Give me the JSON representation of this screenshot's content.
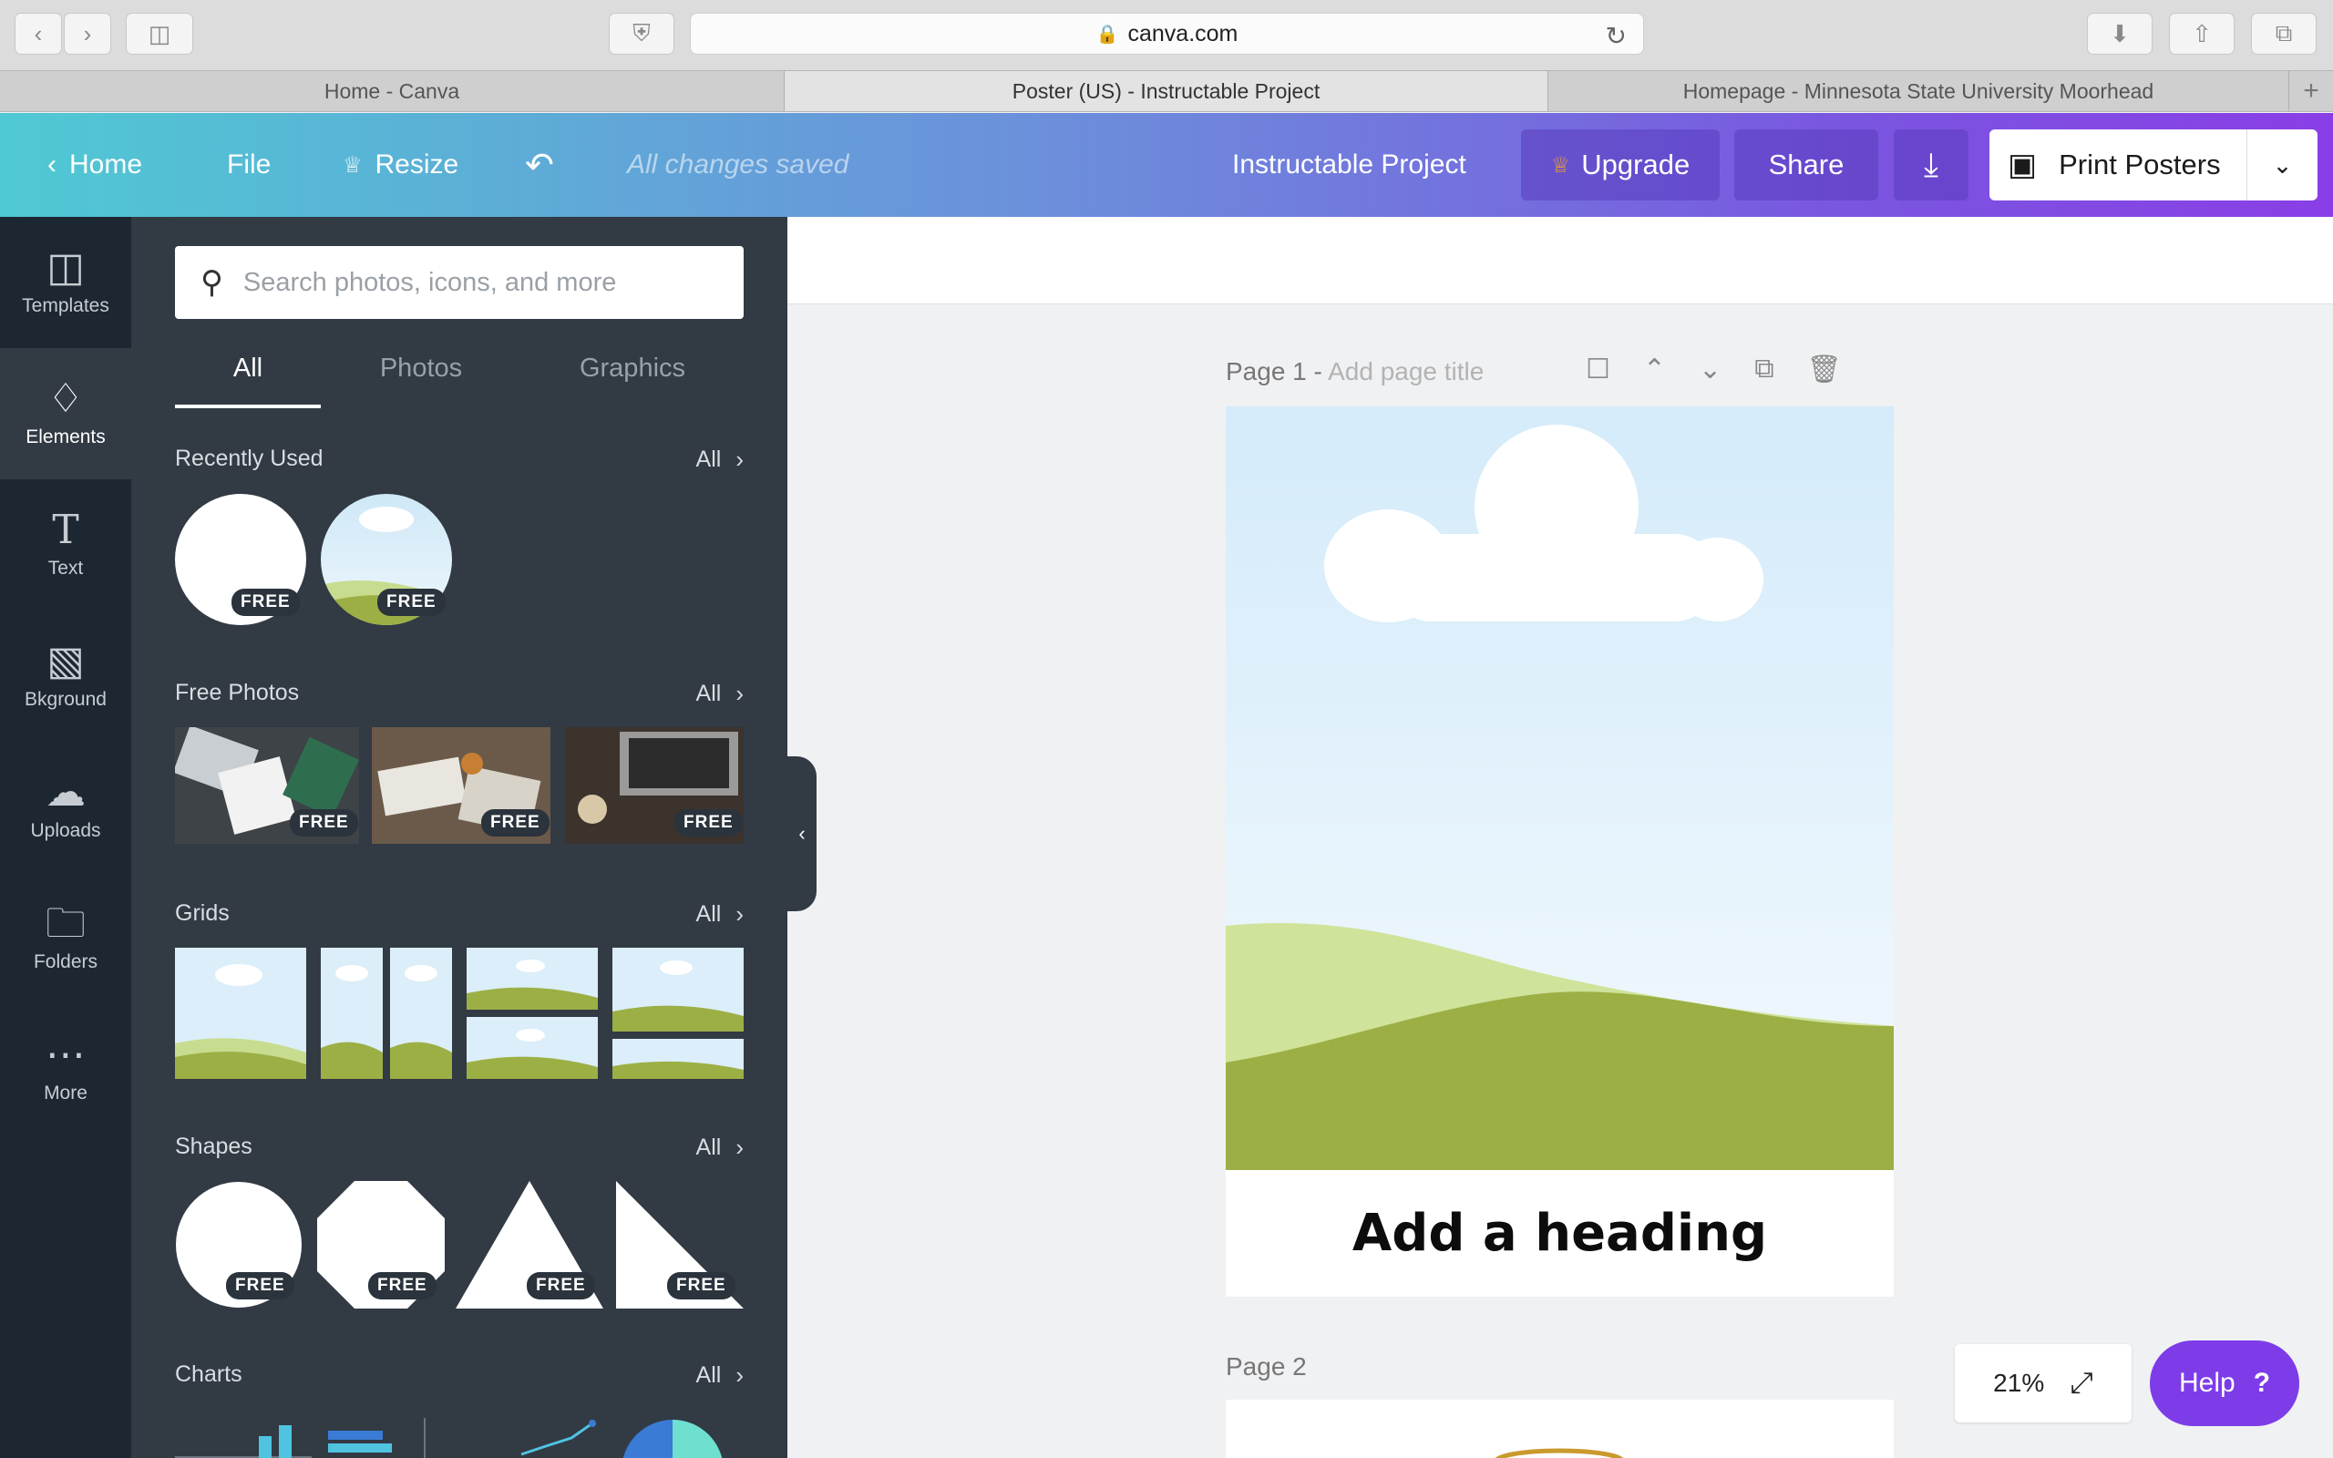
{
  "browser": {
    "url": "canva.com",
    "tabs": [
      {
        "title": "Home - Canva"
      },
      {
        "title": "Poster (US) - Instructable Project"
      },
      {
        "title": "Homepage - Minnesota State University Moorhead"
      }
    ]
  },
  "header": {
    "home_label": "Home",
    "file_label": "File",
    "resize_label": "Resize",
    "save_status": "All changes saved",
    "project_title": "Instructable Project",
    "upgrade_label": "Upgrade",
    "share_label": "Share",
    "print_label": "Print Posters",
    "colors": {
      "gradient_start": "#4fc9d3",
      "gradient_end": "#8a3ee6",
      "upgrade_crown": "#f5a623"
    }
  },
  "rail": {
    "items": [
      {
        "label": "Templates",
        "icon": "layout-icon"
      },
      {
        "label": "Elements",
        "icon": "shapes-icon"
      },
      {
        "label": "Text",
        "icon": "text-icon"
      },
      {
        "label": "Bkground",
        "icon": "background-icon"
      },
      {
        "label": "Uploads",
        "icon": "upload-cloud-icon"
      },
      {
        "label": "Folders",
        "icon": "folder-icon"
      },
      {
        "label": "More",
        "icon": "more-icon"
      }
    ]
  },
  "panel": {
    "search_placeholder": "Search photos, icons, and more",
    "tabs": [
      {
        "label": "All"
      },
      {
        "label": "Photos"
      },
      {
        "label": "Graphics"
      }
    ],
    "sections": {
      "recent": {
        "title": "Recently Used",
        "all": "All"
      },
      "photos": {
        "title": "Free Photos",
        "all": "All"
      },
      "grids": {
        "title": "Grids",
        "all": "All"
      },
      "shapes": {
        "title": "Shapes",
        "all": "All"
      },
      "charts": {
        "title": "Charts",
        "all": "All"
      }
    },
    "badge": "FREE"
  },
  "canvas": {
    "page1_label": "Page 1 - ",
    "page1_placeholder": "Add page title",
    "heading": "Add a heading",
    "page2_label": "Page 2"
  },
  "footer": {
    "zoom": "21%",
    "help_label": "Help",
    "help_icon": "?"
  }
}
